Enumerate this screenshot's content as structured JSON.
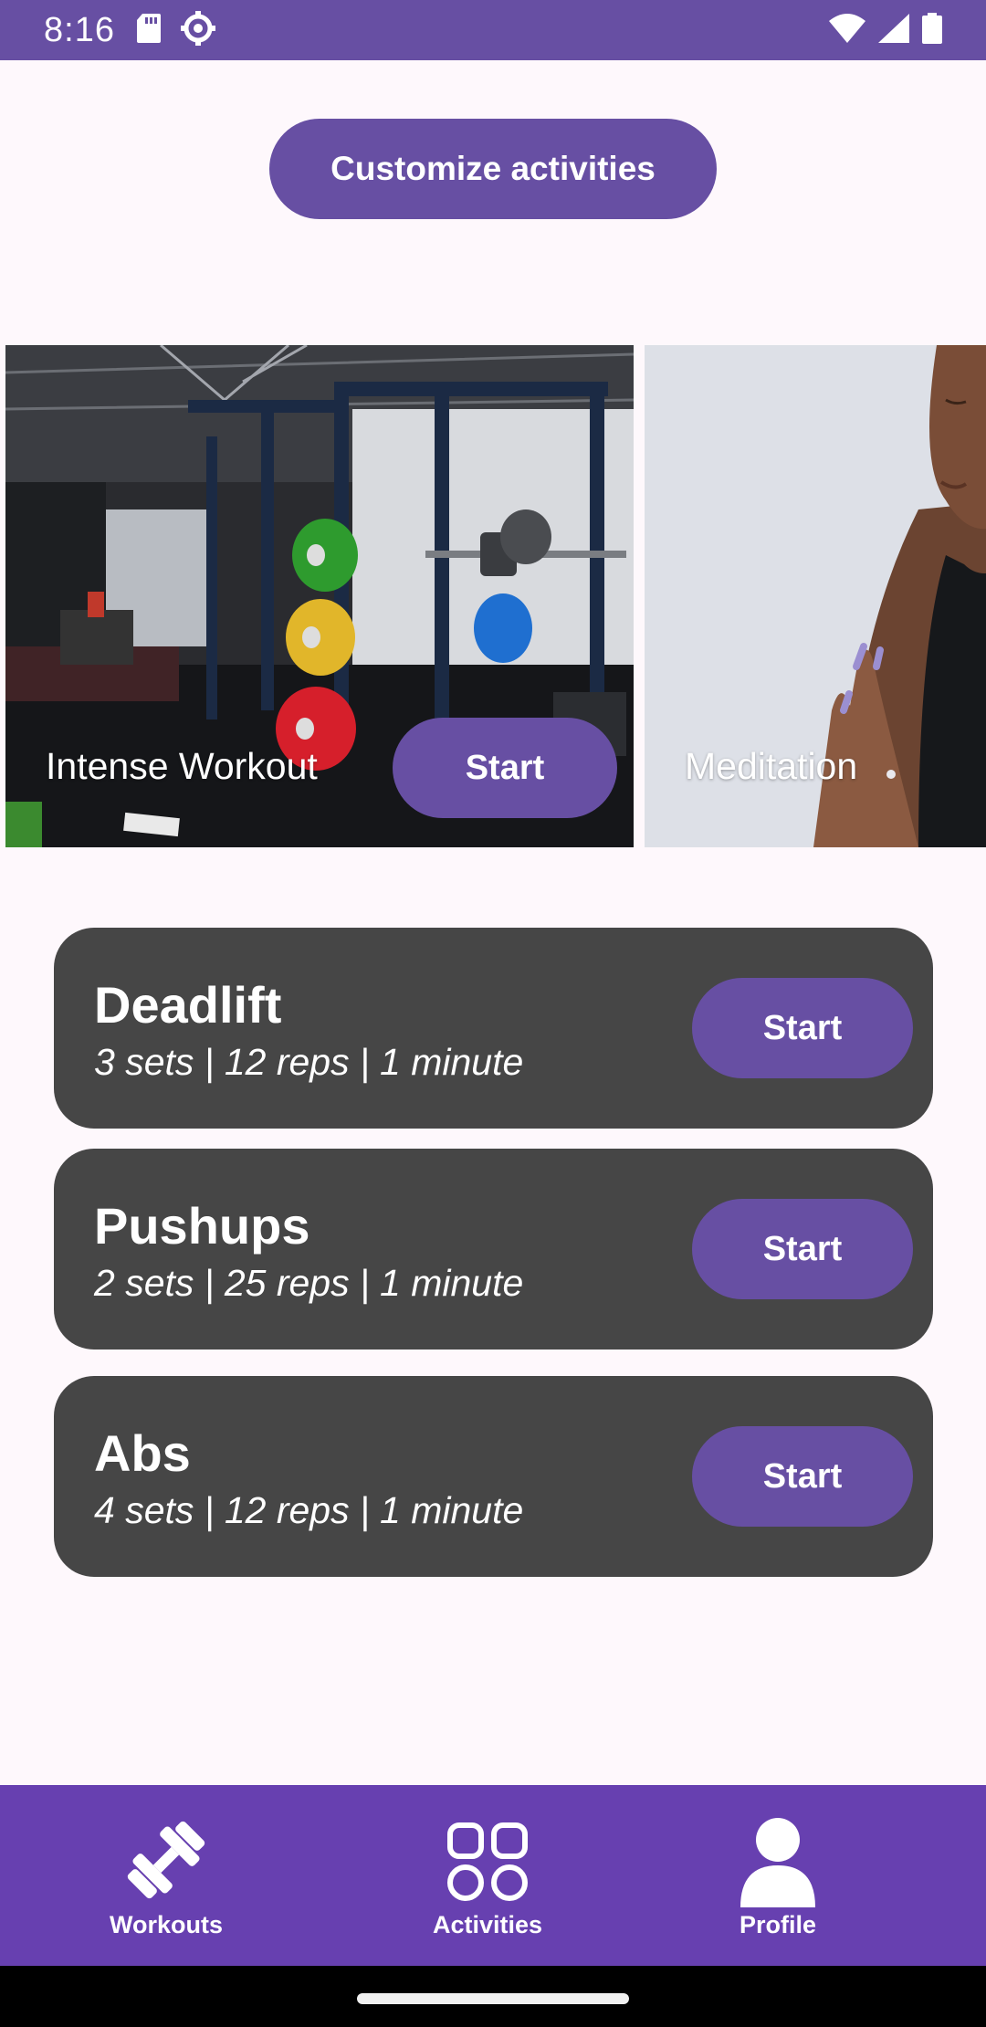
{
  "status_bar": {
    "time": "8:16",
    "icons": [
      "sd-card-icon",
      "settings-gear-icon",
      "wifi-icon",
      "signal-icon",
      "battery-icon"
    ]
  },
  "customize_button": {
    "label": "Customize activities"
  },
  "carousel": {
    "items": [
      {
        "label": "Intense Workout",
        "start_label": "Start",
        "image": "gym-photo"
      },
      {
        "label": "Meditation",
        "image": "meditation-photo"
      }
    ]
  },
  "exercises": [
    {
      "name": "Deadlift",
      "detail": "3 sets | 12 reps | 1 minute",
      "start_label": "Start"
    },
    {
      "name": "Pushups",
      "detail": "2 sets | 25 reps | 1 minute",
      "start_label": "Start"
    },
    {
      "name": "Abs",
      "detail": "4 sets | 12 reps | 1 minute",
      "start_label": "Start"
    }
  ],
  "bottom_nav": {
    "items": [
      {
        "label": "Workouts",
        "icon": "dumbbell-icon"
      },
      {
        "label": "Activities",
        "icon": "grid-icon"
      },
      {
        "label": "Profile",
        "icon": "person-icon"
      }
    ]
  },
  "colors": {
    "primary": "#674fa3",
    "nav_background": "#6740b0",
    "card_background": "#464646",
    "page_background": "#fef8fc"
  }
}
